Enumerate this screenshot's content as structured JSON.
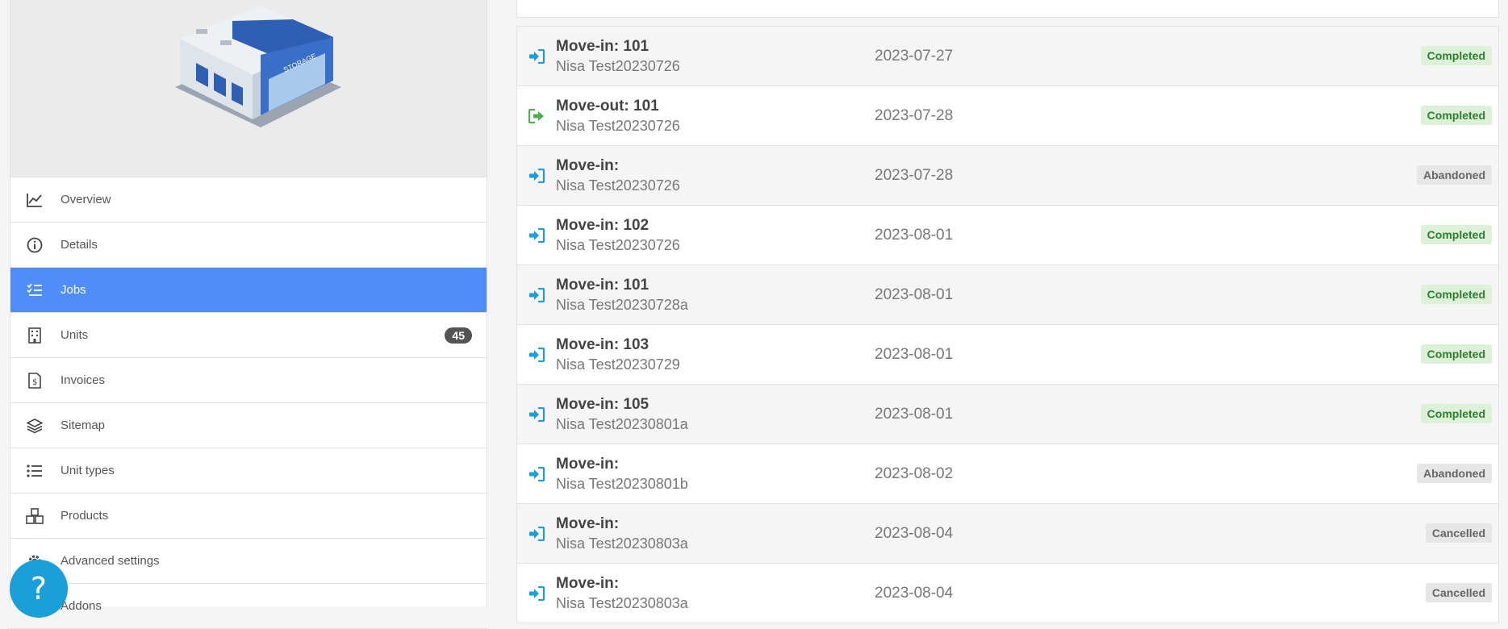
{
  "sidebar": {
    "items": [
      {
        "key": "overview",
        "label": "Overview",
        "icon": "chart-line-icon",
        "active": false
      },
      {
        "key": "details",
        "label": "Details",
        "icon": "info-circle-icon",
        "active": false
      },
      {
        "key": "jobs",
        "label": "Jobs",
        "icon": "list-check-icon",
        "active": true
      },
      {
        "key": "units",
        "label": "Units",
        "icon": "building-icon",
        "active": false,
        "badge": "45"
      },
      {
        "key": "invoices",
        "label": "Invoices",
        "icon": "invoice-icon",
        "active": false
      },
      {
        "key": "sitemap",
        "label": "Sitemap",
        "icon": "layers-icon",
        "active": false
      },
      {
        "key": "unit-types",
        "label": "Unit types",
        "icon": "list-icon",
        "active": false
      },
      {
        "key": "products",
        "label": "Products",
        "icon": "boxes-icon",
        "active": false
      },
      {
        "key": "advanced-settings",
        "label": "Advanced settings",
        "icon": "gear-icon",
        "active": false
      },
      {
        "key": "addons",
        "label": "Addons",
        "icon": "puzzle-icon",
        "active": false
      }
    ],
    "help_label": "?"
  },
  "jobs": [
    {
      "title": "Move-in: 101",
      "customer": "Nisa Test20230726",
      "date": "2023-07-27",
      "status": "Completed",
      "type": "move-in"
    },
    {
      "title": "Move-out: 101",
      "customer": "Nisa Test20230726",
      "date": "2023-07-28",
      "status": "Completed",
      "type": "move-out"
    },
    {
      "title": "Move-in:",
      "customer": "Nisa Test20230726",
      "date": "2023-07-28",
      "status": "Abandoned",
      "type": "move-in"
    },
    {
      "title": "Move-in: 102",
      "customer": "Nisa Test20230726",
      "date": "2023-08-01",
      "status": "Completed",
      "type": "move-in"
    },
    {
      "title": "Move-in: 101",
      "customer": "Nisa Test20230728a",
      "date": "2023-08-01",
      "status": "Completed",
      "type": "move-in"
    },
    {
      "title": "Move-in: 103",
      "customer": "Nisa Test20230729",
      "date": "2023-08-01",
      "status": "Completed",
      "type": "move-in"
    },
    {
      "title": "Move-in: 105",
      "customer": "Nisa Test20230801a",
      "date": "2023-08-01",
      "status": "Completed",
      "type": "move-in"
    },
    {
      "title": "Move-in:",
      "customer": "Nisa Test20230801b",
      "date": "2023-08-02",
      "status": "Abandoned",
      "type": "move-in"
    },
    {
      "title": "Move-in:",
      "customer": "Nisa Test20230803a",
      "date": "2023-08-04",
      "status": "Cancelled",
      "type": "move-in"
    },
    {
      "title": "Move-in:",
      "customer": "Nisa Test20230803a",
      "date": "2023-08-04",
      "status": "Cancelled",
      "type": "move-in"
    }
  ],
  "colors": {
    "accent": "#4f8ef7",
    "move_in": "#1a9fd8",
    "move_out": "#4caf50",
    "completed_bg": "#ddf1d8"
  }
}
